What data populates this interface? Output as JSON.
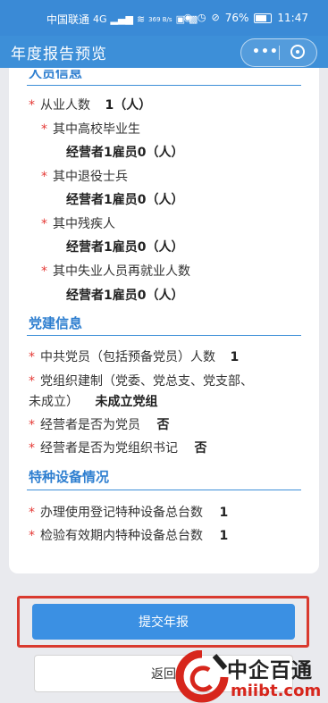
{
  "status_bar": {
    "carrier": "中国联通",
    "network": "4G",
    "speed": "369 B/s",
    "battery": "76%",
    "time": "11:47"
  },
  "nav": {
    "title": "年度报告预览",
    "more": "•••"
  },
  "personnel": {
    "section_title": "人员信息",
    "employee_count_label": "从业人数",
    "employee_count_value": "1（人）",
    "items": [
      {
        "label": "其中高校毕业生",
        "value": "经营者1雇员0（人）"
      },
      {
        "label": "其中退役士兵",
        "value": "经营者1雇员0（人）"
      },
      {
        "label": "其中残疾人",
        "value": "经营者1雇员0（人）"
      },
      {
        "label": "其中失业人员再就业人数",
        "value": "经营者1雇员0（人）"
      }
    ]
  },
  "party": {
    "section_title": "党建信息",
    "members_label": "中共党员（包括预备党员）人数",
    "members_value": "1",
    "org_label_line1": "党组织建制（党委、党总支、党支部、",
    "org_label_line2": "未成立）",
    "org_value": "未成立党组",
    "is_member_label": "经营者是否为党员",
    "is_member_value": "否",
    "is_secretary_label": "经营者是否为党组织书记",
    "is_secretary_value": "否"
  },
  "equipment": {
    "section_title": "特种设备情况",
    "registered_label": "办理使用登记特种设备总台数",
    "registered_value": "1",
    "inspected_label": "检验有效期内特种设备总台数",
    "inspected_value": "1"
  },
  "actions": {
    "submit": "提交年报",
    "back": "返回"
  },
  "watermark": {
    "title": "中企百通",
    "domain": "miibt.com"
  },
  "colors": {
    "accent": "#3d8fd8",
    "required": "#e53935",
    "highlight": "#d93a2f",
    "button": "#3b90e3"
  }
}
